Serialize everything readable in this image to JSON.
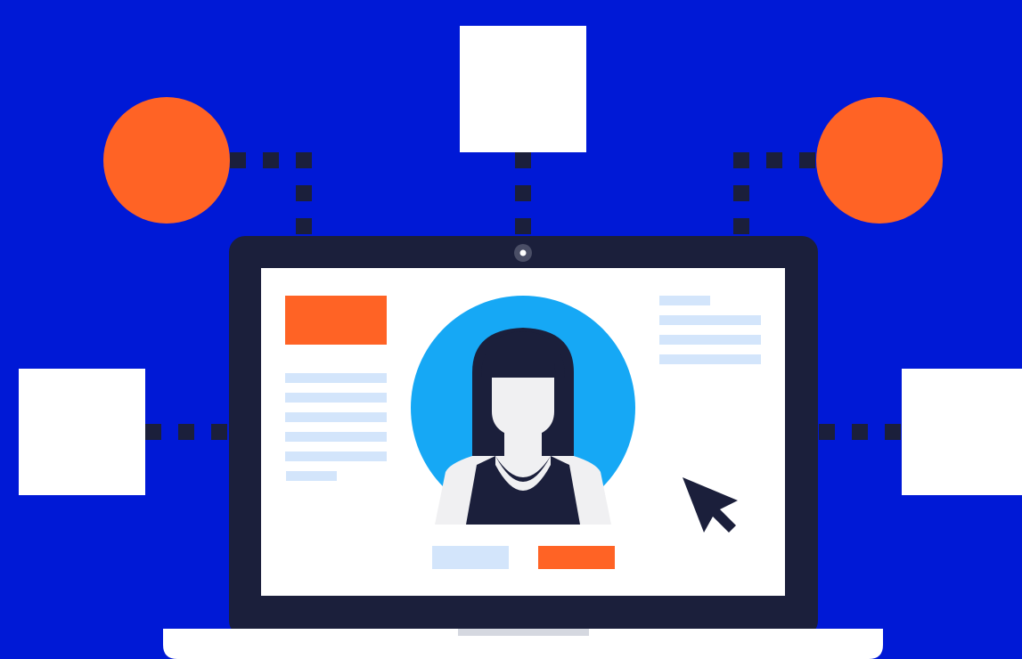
{
  "colors": {
    "background": "#0019d6",
    "laptop_frame": "#1b1f3b",
    "screen": "#ffffff",
    "accent_orange": "#ff6325",
    "avatar_circle": "#16a8f5",
    "placeholder_line": "#d3e5fb",
    "laptop_base": "#ffffff",
    "base_notch": "#d5d8e0",
    "connector": "#1b1f3b",
    "node_white": "#ffffff"
  },
  "icons": {
    "avatar": "woman-avatar-icon",
    "cursor": "mouse-pointer-icon",
    "camera": "webcam-icon"
  }
}
